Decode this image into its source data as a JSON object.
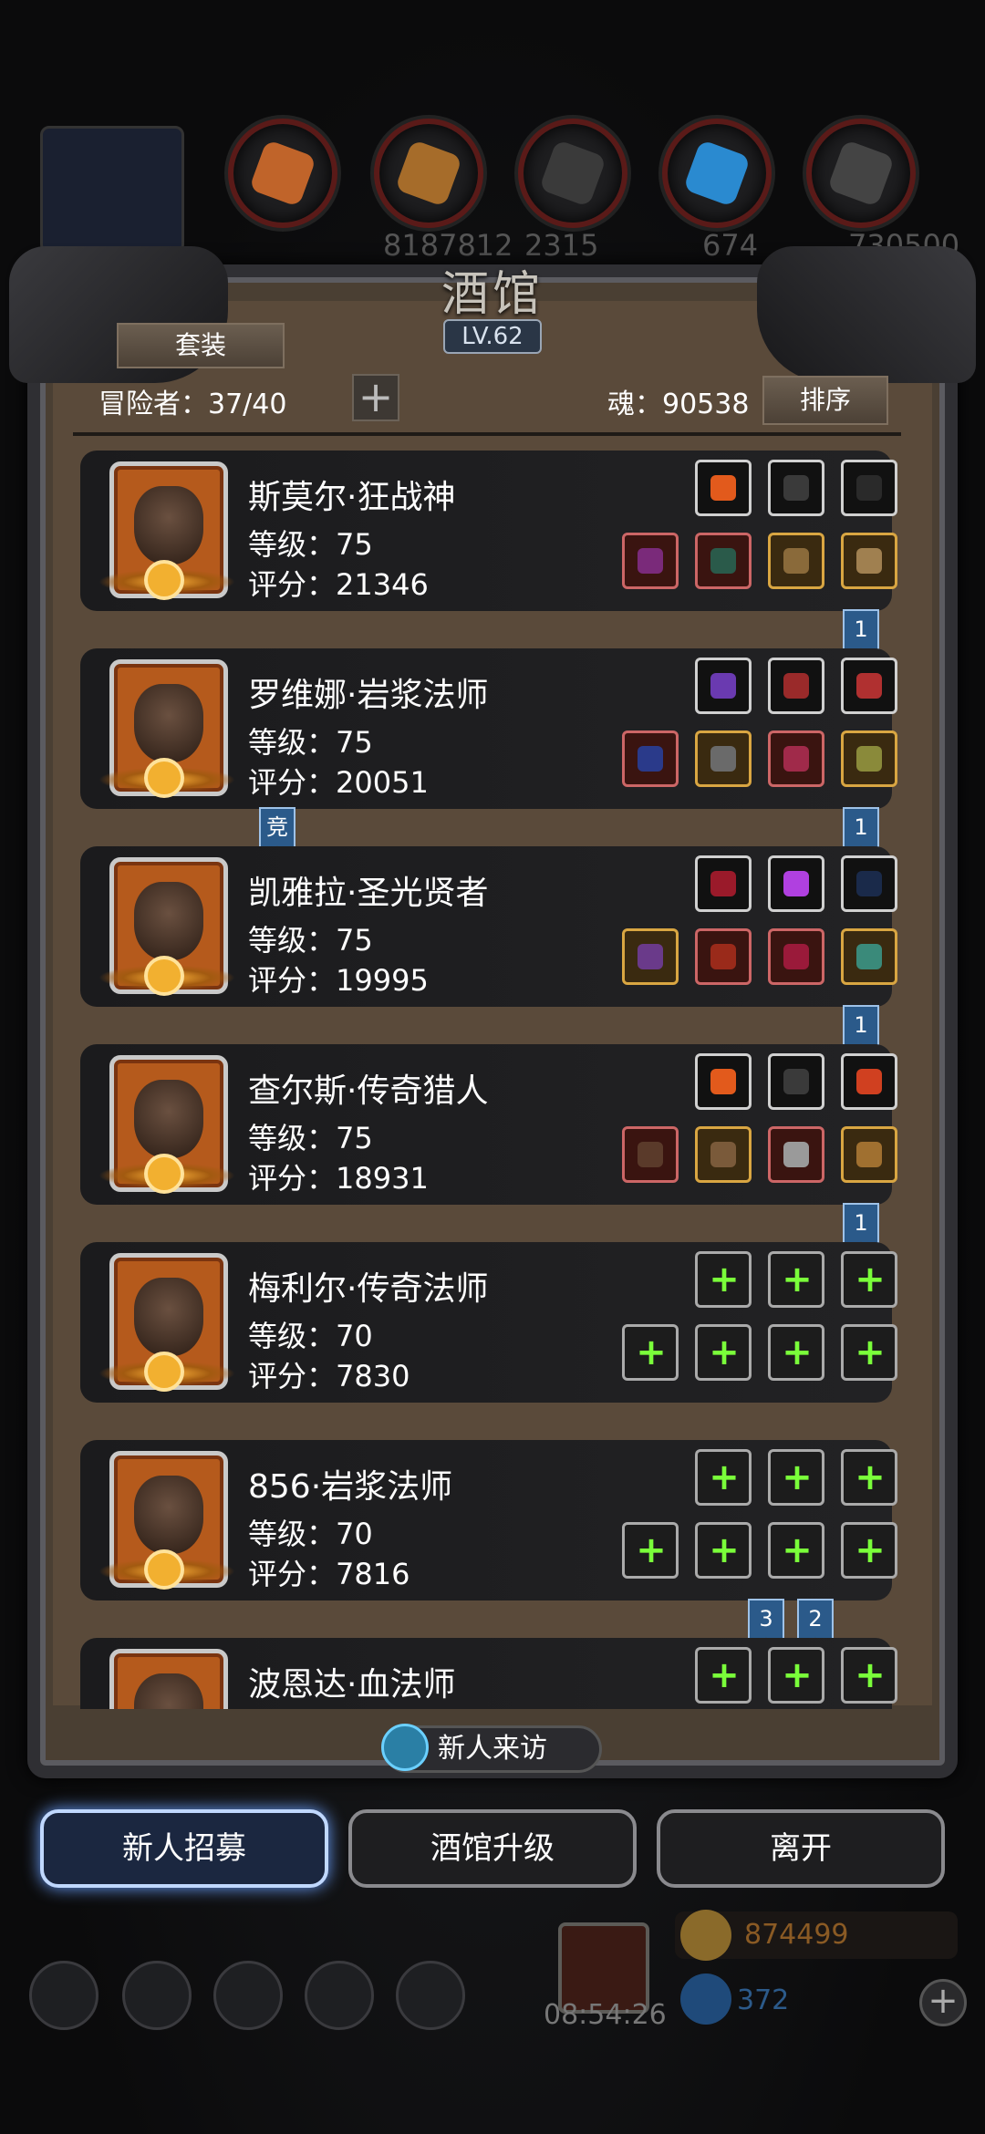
{
  "resources": [
    {
      "icon": "dragon-portrait-icon",
      "value": ""
    },
    {
      "icon": "meat-resource-icon",
      "value": "",
      "color": "#c0642a"
    },
    {
      "icon": "wood-resource-icon",
      "value": "8187812",
      "color": "#a66c2a"
    },
    {
      "icon": "iron-resource-icon",
      "value": "2315",
      "color": "#3a3a3a"
    },
    {
      "icon": "crystal-resource-icon",
      "value": "674",
      "color": "#2a8ad0"
    },
    {
      "icon": "stone-resource-icon",
      "value": "730500",
      "color": "#444"
    }
  ],
  "header": {
    "title": "酒馆",
    "level": "LV.62",
    "outfit_button": "套装",
    "adventurers": "冒险者：37/40",
    "soul": "魂：90538",
    "sort_button": "排序",
    "add_label": "+"
  },
  "heroes": [
    {
      "name": "斯莫尔·狂战神",
      "level": "等级：75",
      "score": "评分：21346",
      "tags": [
        "1"
      ],
      "slots_top": [
        "#e25a1c",
        "#3a3a3a",
        "#2a2a2a"
      ],
      "slots_bottom": [
        {
          "c": "#7a2a7a",
          "s": "red"
        },
        {
          "c": "#2a5a4a",
          "s": "red"
        },
        {
          "c": "#8a6a3a",
          "s": "gold"
        },
        {
          "c": "#a08050",
          "s": "gold"
        }
      ]
    },
    {
      "name": "罗维娜·岩浆法师",
      "level": "等级：75",
      "score": "评分：20051",
      "tags": [
        "竞",
        "1"
      ],
      "slots_top": [
        "#6a3ab0",
        "#9a2a2a",
        "#b03030"
      ],
      "slots_bottom": [
        {
          "c": "#2a3a8a",
          "s": "red"
        },
        {
          "c": "#6a6a6a",
          "s": "gold"
        },
        {
          "c": "#a02a4a",
          "s": "red"
        },
        {
          "c": "#8a8a3a",
          "s": "gold"
        }
      ]
    },
    {
      "name": "凯雅拉·圣光贤者",
      "level": "等级：75",
      "score": "评分：19995",
      "tags": [
        "1"
      ],
      "slots_top": [
        "#9a1a2a",
        "#b040e0",
        "#1a2a4a"
      ],
      "slots_bottom": [
        {
          "c": "#6a3a8a",
          "s": "gold"
        },
        {
          "c": "#9a2a1a",
          "s": "red"
        },
        {
          "c": "#9a1a3a",
          "s": "red"
        },
        {
          "c": "#3a8a7a",
          "s": "gold"
        }
      ]
    },
    {
      "name": "查尔斯·传奇猎人",
      "level": "等级：75",
      "score": "评分：18931",
      "tags": [
        "1"
      ],
      "slots_top": [
        "#e25a1c",
        "#3a3a3a",
        "#d04020"
      ],
      "slots_bottom": [
        {
          "c": "#5a3a2a",
          "s": "red"
        },
        {
          "c": "#7a5a3a",
          "s": "gold"
        },
        {
          "c": "#9a9a9a",
          "s": "red"
        },
        {
          "c": "#a07030",
          "s": "gold"
        }
      ]
    },
    {
      "name": "梅利尔·传奇法师",
      "level": "等级：70",
      "score": "评分：7830",
      "tags": [],
      "add": true
    },
    {
      "name": "856·岩浆法师",
      "level": "等级：70",
      "score": "评分：7816",
      "tags": [
        "3",
        "2"
      ],
      "add": true
    },
    {
      "name": "波恩达·血法师",
      "level": "",
      "score": "",
      "tags": [],
      "add": true,
      "partial": true
    }
  ],
  "bottom": {
    "visit": "新人来访",
    "recruit": "新人招募",
    "upgrade": "酒馆升级",
    "leave": "离开",
    "timer": "08:54:26",
    "gold": "874499",
    "gems": "372",
    "plus": "+"
  }
}
